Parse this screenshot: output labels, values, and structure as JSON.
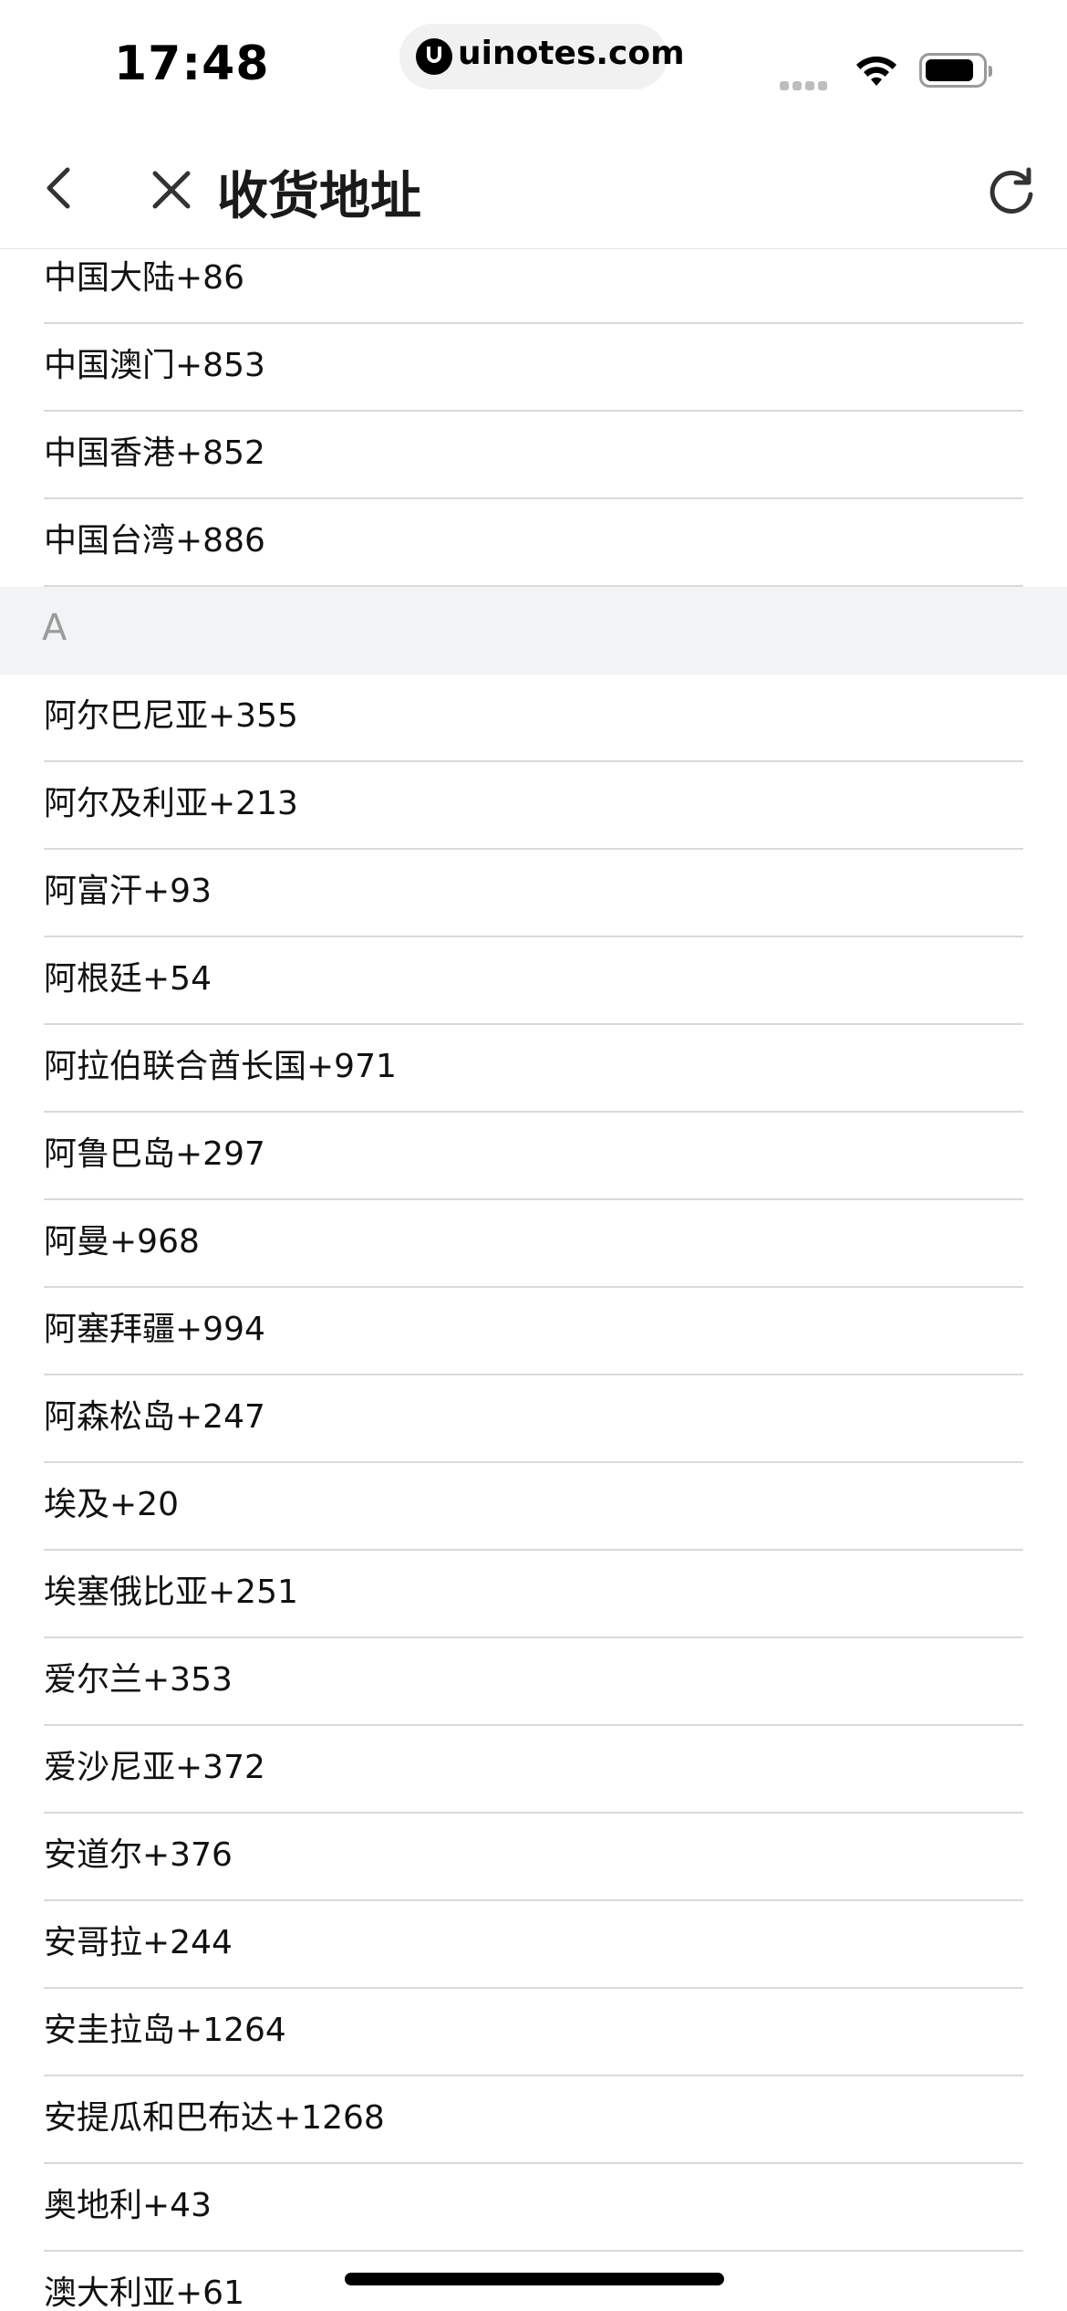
{
  "status_bar": {
    "time": "17:48",
    "url": "uinotes.com"
  },
  "nav": {
    "title": "收货地址"
  },
  "list": {
    "top_rows": [
      "中国大陆+86",
      "中国澳门+853",
      "中国香港+852",
      "中国台湾+886"
    ],
    "section_a": {
      "header": "A",
      "rows": [
        "阿尔巴尼亚+355",
        "阿尔及利亚+213",
        "阿富汗+93",
        "阿根廷+54",
        "阿拉伯联合酋长国+971",
        "阿鲁巴岛+297",
        "阿曼+968",
        "阿塞拜疆+994",
        "阿森松岛+247",
        "埃及+20",
        "埃塞俄比亚+251",
        "爱尔兰+353",
        "爱沙尼亚+372",
        "安道尔+376",
        "安哥拉+244",
        "安圭拉岛+1264",
        "安提瓜和巴布达+1268",
        "奥地利+43",
        "澳大利亚+61"
      ]
    }
  },
  "icons": {
    "back": "chevron-left-icon",
    "close": "close-icon",
    "refresh": "refresh-icon",
    "wifi": "wifi-icon",
    "battery": "battery-icon"
  },
  "colors": {
    "section_header_bg": "#f2f3f5",
    "section_header_text": "#9b9b9b",
    "divider": "#d9d9d9"
  }
}
